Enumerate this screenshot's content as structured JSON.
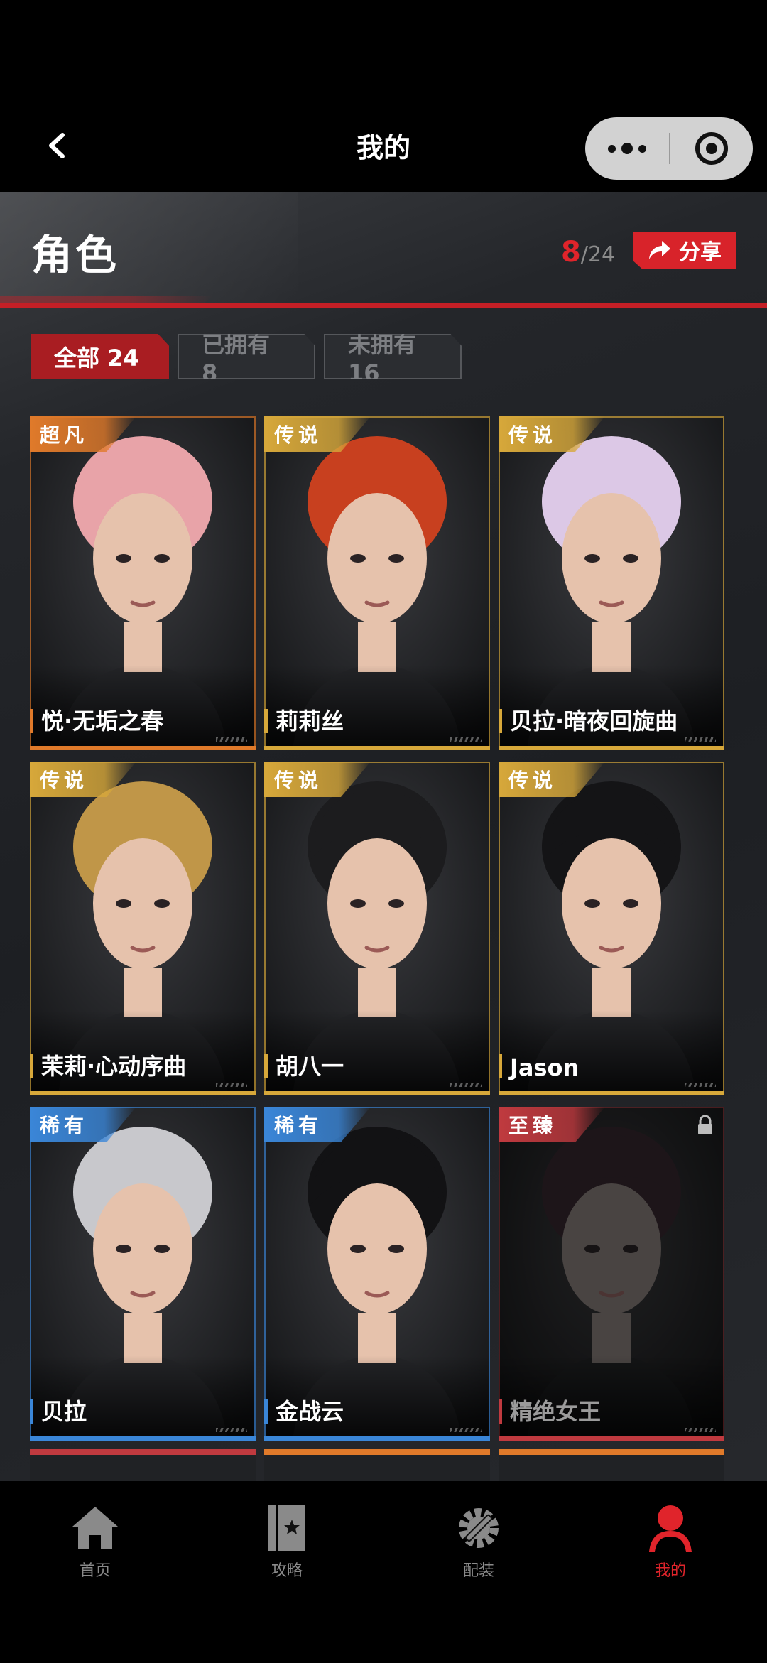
{
  "header": {
    "title": "我的"
  },
  "section": {
    "title": "角色",
    "owned_count": "8",
    "total_count": "/24",
    "share_label": "分享"
  },
  "filters": [
    {
      "label": "全部 24",
      "active": true
    },
    {
      "label": "已拥有 8",
      "active": false
    },
    {
      "label": "未拥有 16",
      "active": false
    }
  ],
  "rarity_colors": {
    "超凡": "#e07a2a",
    "传说": "#d7a83a",
    "稀有": "#3a86d8",
    "至臻": "#c03a3f"
  },
  "characters": [
    {
      "rarity": "超凡",
      "name": "悦·无垢之春",
      "locked": false,
      "hair": "#e8a3a8"
    },
    {
      "rarity": "传说",
      "name": "莉莉丝",
      "locked": false,
      "hair": "#c8401f"
    },
    {
      "rarity": "传说",
      "name": "贝拉·暗夜回旋曲",
      "locked": false,
      "hair": "#dcc8e6"
    },
    {
      "rarity": "传说",
      "name": "茉莉·心动序曲",
      "locked": false,
      "hair": "#c09648"
    },
    {
      "rarity": "传说",
      "name": "胡八一",
      "locked": false,
      "hair": "#1c1c1e"
    },
    {
      "rarity": "传说",
      "name": "Jason",
      "locked": false,
      "hair": "#141416"
    },
    {
      "rarity": "稀有",
      "name": "贝拉",
      "locked": false,
      "hair": "#c8c8cc"
    },
    {
      "rarity": "稀有",
      "name": "金战云",
      "locked": false,
      "hair": "#121214"
    },
    {
      "rarity": "至臻",
      "name": "精绝女王",
      "locked": true,
      "hair": "#3a2530"
    }
  ],
  "tabbar": [
    {
      "label": "首页",
      "icon": "home-icon",
      "active": false
    },
    {
      "label": "攻略",
      "icon": "guide-book-icon",
      "active": false
    },
    {
      "label": "配装",
      "icon": "wrench-gear-icon",
      "active": false
    },
    {
      "label": "我的",
      "icon": "user-icon",
      "active": true
    }
  ],
  "accent_color": "#e0242b"
}
